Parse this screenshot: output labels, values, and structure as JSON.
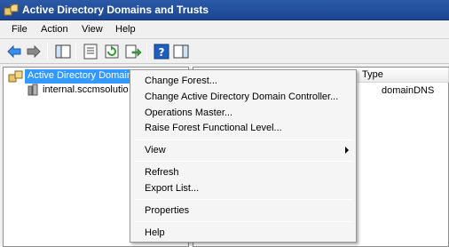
{
  "window": {
    "title": "Active Directory Domains and Trusts"
  },
  "menubar": {
    "items": [
      "File",
      "Action",
      "View",
      "Help"
    ]
  },
  "toolbar": {
    "buttons": [
      "back-icon",
      "forward-icon",
      "show-hide-tree-icon",
      "properties-icon",
      "refresh-icon",
      "export-list-icon",
      "help-icon",
      "action-pane-icon"
    ]
  },
  "tree": {
    "root": "Active Directory Domain",
    "child": "internal.sccmsolutio"
  },
  "list": {
    "columns": [
      "Type"
    ],
    "rows": [
      {
        "type": "domainDNS"
      }
    ]
  },
  "context_menu": {
    "items": [
      {
        "label": "Change Forest..."
      },
      {
        "label": "Change Active Directory Domain Controller..."
      },
      {
        "label": "Operations Master..."
      },
      {
        "label": "Raise Forest Functional Level..."
      },
      {
        "label": "View",
        "submenu": true
      },
      {
        "label": "Refresh"
      },
      {
        "label": "Export List..."
      },
      {
        "label": "Properties"
      },
      {
        "label": "Help"
      }
    ]
  },
  "colors": {
    "title_bar": "#2b5aa8",
    "selection": "#3399ff"
  }
}
